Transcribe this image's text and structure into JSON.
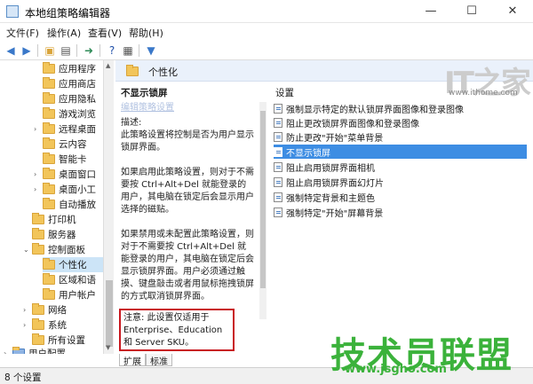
{
  "window": {
    "title": "本地组策略编辑器",
    "min": "—",
    "max": "☐",
    "close": "✕"
  },
  "menu": [
    "文件(F)",
    "操作(A)",
    "查看(V)",
    "帮助(H)"
  ],
  "tree": {
    "items": [
      {
        "label": "应用程序"
      },
      {
        "label": "应用商店"
      },
      {
        "label": "应用隐私"
      },
      {
        "label": "游戏浏览"
      },
      {
        "label": "远程桌面"
      },
      {
        "label": "云内容"
      },
      {
        "label": "智能卡"
      },
      {
        "label": "桌面窗口"
      },
      {
        "label": "桌面小工"
      },
      {
        "label": "自动播放"
      },
      {
        "label": "打印机"
      },
      {
        "label": "服务器"
      },
      {
        "label": "控制面板"
      },
      {
        "label": "个性化"
      },
      {
        "label": "区域和语"
      },
      {
        "label": "用户帐户"
      },
      {
        "label": "网络"
      },
      {
        "label": "系统"
      },
      {
        "label": "所有设置"
      },
      {
        "label": "用户配置"
      }
    ]
  },
  "header": {
    "title": "个性化"
  },
  "description": {
    "policy_title": "不显示锁屏",
    "edit_link": "编辑策略设置",
    "req_label": "描述:",
    "req_text": "此策略设置将控制是否为用户显示锁屏界面。",
    "para1": "如果启用此策略设置，则对于不需要按 Ctrl+Alt+Del 就能登录的用户，其电脑在锁定后会显示用户选择的磁贴。",
    "para2": "如果禁用或未配置此策略设置，则对于不需要按 Ctrl+Alt+Del 就能登录的用户，其电脑在锁定后会显示锁屏界面。用户必须通过触摸、键盘敲击或者用鼠标拖拽锁屏的方式取消锁屏界面。",
    "note": "注意: 此设置仅适用于 Enterprise、Education 和 Server SKU。"
  },
  "tabs": [
    "扩展",
    "标准"
  ],
  "list": {
    "header": "设置",
    "items": [
      "强制显示特定的默认锁屏界面图像和登录图像",
      "阻止更改锁屏界面图像和登录图像",
      "防止更改\"开始\"菜单背景",
      "不显示锁屏",
      "阻止启用锁屏界面相机",
      "阻止启用锁屏界面幻灯片",
      "强制特定背景和主题色",
      "强制特定\"开始\"屏幕背景"
    ]
  },
  "status": {
    "text": "8 个设置"
  },
  "watermarks": {
    "top_logo": "IT之家",
    "top_url": "www.ithome.com",
    "bottom_logo": "技术员联盟",
    "bottom_url": "www.jsgho.com"
  }
}
